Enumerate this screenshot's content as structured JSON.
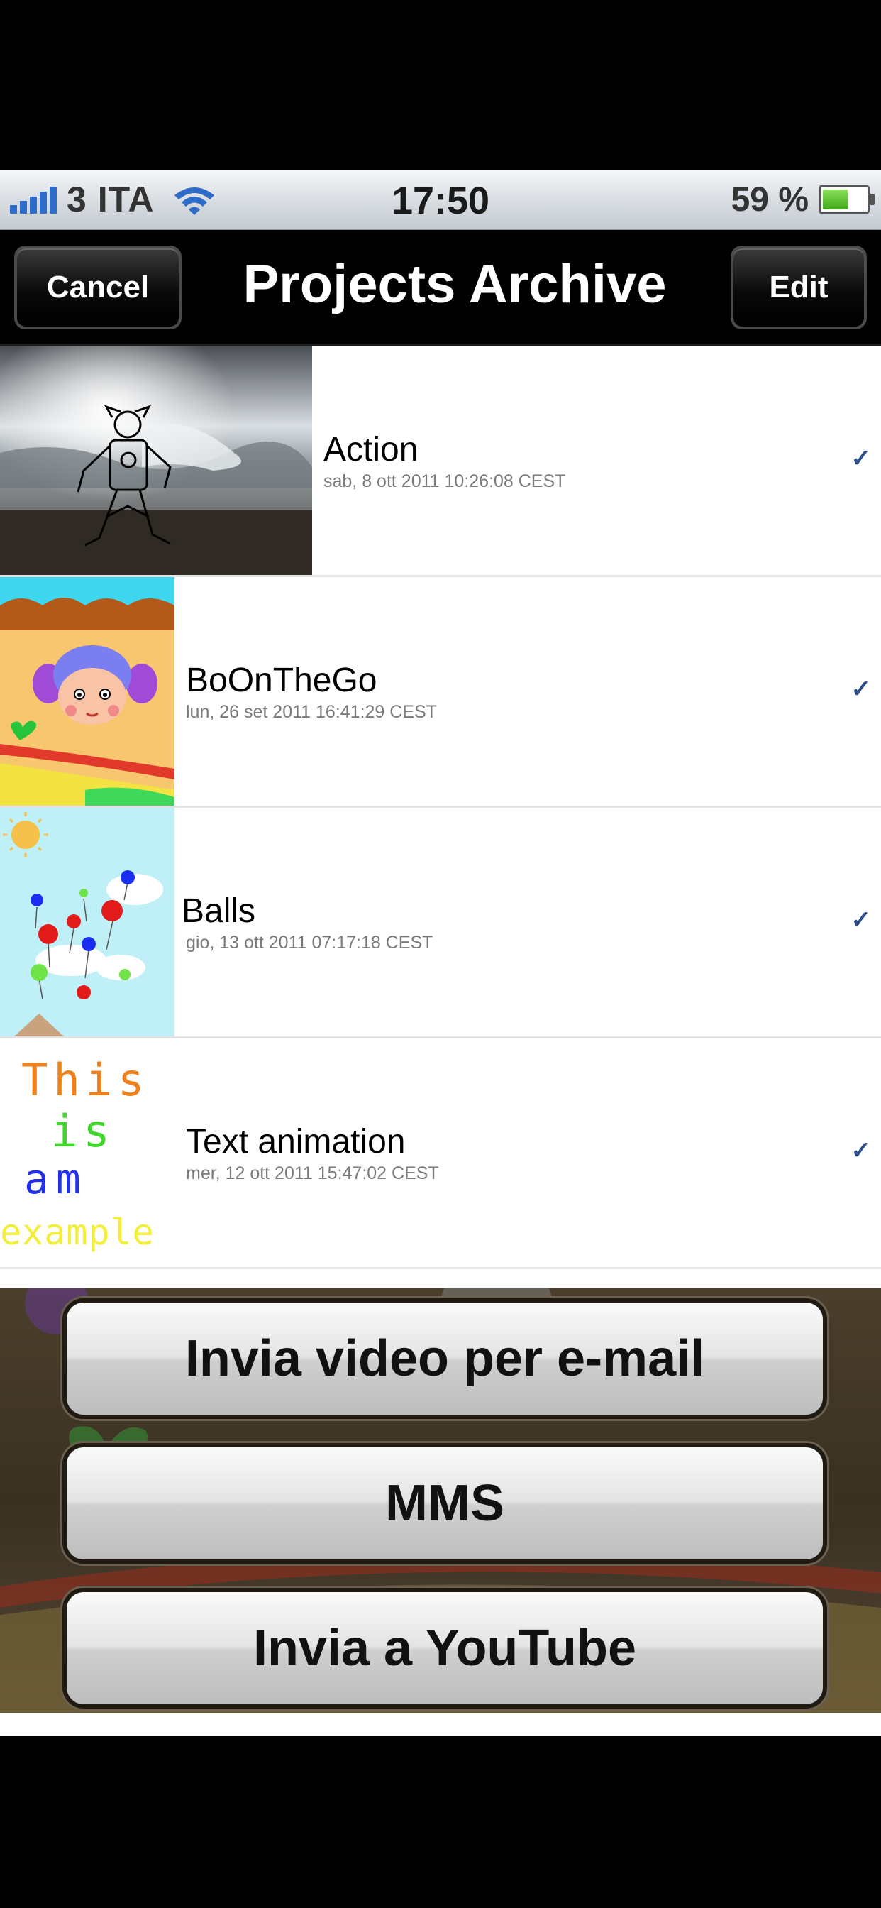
{
  "status_bar": {
    "carrier": "3 ITA",
    "time": "17:50",
    "battery_percent": "59 %",
    "battery_level": 0.59,
    "icons": [
      "signal-bars-icon",
      "wifi-icon",
      "battery-icon"
    ]
  },
  "nav": {
    "title": "Projects Archive",
    "cancel_label": "Cancel",
    "edit_label": "Edit"
  },
  "projects": [
    {
      "title": "Action",
      "date": "sab, 8 ott 2011 10:26:08 CEST",
      "checked": true
    },
    {
      "title": "BoOnTheGo",
      "date": "lun, 26 set 2011 16:41:29 CEST",
      "checked": true
    },
    {
      "title": "Balls",
      "date": "gio, 13 ott 2011 07:17:18 CEST",
      "checked": true
    },
    {
      "title": "Text animation",
      "date": "mer, 12 ott 2011 15:47:02 CEST",
      "checked": true
    }
  ],
  "thumbnails": {
    "text_animation_lines": [
      "This",
      "is",
      "am",
      "example"
    ]
  },
  "check_glyph": "✓",
  "action_sheet": {
    "email_label": "Invia video per e-mail",
    "mms_label": "MMS",
    "youtube_label": "Invia a YouTube"
  },
  "colors": {
    "accent_check": "#2b4d8c",
    "nav_background": "#000000",
    "battery_green": "#3fa818"
  }
}
